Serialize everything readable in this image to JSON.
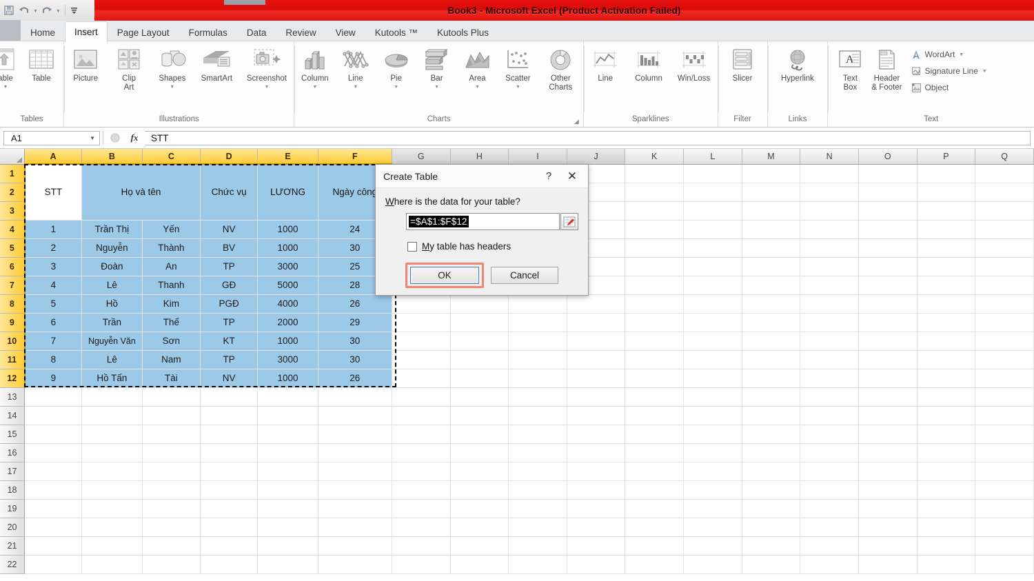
{
  "titlebar": {
    "title": "Book3  -  Microsoft Excel (Product Activation Failed)",
    "qat": [
      {
        "name": "save",
        "glyph": "▤"
      },
      {
        "name": "undo",
        "glyph": "↶"
      },
      {
        "name": "redo",
        "glyph": "↷"
      },
      {
        "name": "customize-quick-access-toolbar",
        "glyph": "☷"
      }
    ]
  },
  "tabs": [
    {
      "label": "Home",
      "active": false
    },
    {
      "label": "Insert",
      "active": true
    },
    {
      "label": "Page Layout",
      "active": false
    },
    {
      "label": "Formulas",
      "active": false
    },
    {
      "label": "Data",
      "active": false
    },
    {
      "label": "Review",
      "active": false
    },
    {
      "label": "View",
      "active": false
    },
    {
      "label": "Kutools ™",
      "active": false
    },
    {
      "label": "Kutools Plus",
      "active": false
    }
  ],
  "ribbon": {
    "groups": [
      {
        "name": "Tables",
        "label": "Tables",
        "items": [
          {
            "label": "able",
            "icon": "pivottable-icon",
            "caret": true
          },
          {
            "label": "Table",
            "icon": "table-icon",
            "caret": false
          }
        ]
      },
      {
        "name": "Illustrations",
        "label": "Illustrations",
        "items": [
          {
            "label": "Picture",
            "icon": "picture-icon",
            "caret": false
          },
          {
            "label": "Clip\nArt",
            "icon": "clipart-icon",
            "caret": false
          },
          {
            "label": "Shapes",
            "icon": "shapes-icon",
            "caret": true
          },
          {
            "label": "SmartArt",
            "icon": "smartart-icon",
            "caret": false
          },
          {
            "label": "Screenshot",
            "icon": "screenshot-icon",
            "caret": true
          }
        ]
      },
      {
        "name": "Charts",
        "label": "Charts",
        "launcher": true,
        "items": [
          {
            "label": "Column",
            "icon": "column-chart-icon",
            "caret": true
          },
          {
            "label": "Line",
            "icon": "line-chart-icon",
            "caret": true
          },
          {
            "label": "Pie",
            "icon": "pie-chart-icon",
            "caret": true
          },
          {
            "label": "Bar",
            "icon": "bar-chart-icon",
            "caret": true
          },
          {
            "label": "Area",
            "icon": "area-chart-icon",
            "caret": true
          },
          {
            "label": "Scatter",
            "icon": "scatter-chart-icon",
            "caret": true
          },
          {
            "label": "Other\nCharts",
            "icon": "other-charts-icon",
            "caret": true,
            "inline_caret": true
          }
        ]
      },
      {
        "name": "Sparklines",
        "label": "Sparklines",
        "items": [
          {
            "label": "Line",
            "icon": "sparkline-line-icon",
            "caret": false
          },
          {
            "label": "Column",
            "icon": "sparkline-column-icon",
            "caret": false
          },
          {
            "label": "Win/Loss",
            "icon": "sparkline-winloss-icon",
            "caret": false
          }
        ]
      },
      {
        "name": "Filter",
        "label": "Filter",
        "items": [
          {
            "label": "Slicer",
            "icon": "slicer-icon",
            "caret": false
          }
        ]
      },
      {
        "name": "Links",
        "label": "Links",
        "items": [
          {
            "label": "Hyperlink",
            "icon": "hyperlink-icon",
            "caret": false
          }
        ]
      },
      {
        "name": "Text",
        "label": "Text",
        "items": [
          {
            "label": "Text\nBox",
            "icon": "textbox-icon",
            "caret": false
          },
          {
            "label": "Header\n& Footer",
            "icon": "header-footer-icon",
            "caret": false
          }
        ],
        "small_items": [
          {
            "label": "WordArt",
            "icon": "wordart-icon",
            "caret": true
          },
          {
            "label": "Signature Line",
            "icon": "signature-line-icon",
            "caret": true
          },
          {
            "label": "Object",
            "icon": "object-icon",
            "caret": false
          }
        ]
      }
    ]
  },
  "formula_bar": {
    "name_box": "A1",
    "formula": "STT",
    "fx_label": "fx",
    "cancel_glyph": "●"
  },
  "grid": {
    "columns": [
      "A",
      "B",
      "C",
      "D",
      "E",
      "F",
      "G",
      "H",
      "I",
      "J",
      "K",
      "L",
      "M",
      "N",
      "O",
      "P",
      "Q"
    ],
    "selected_columns": [
      "A",
      "B",
      "C",
      "D",
      "E",
      "F"
    ],
    "near_selected_columns": [
      "G",
      "H",
      "I",
      "J"
    ],
    "rows": [
      "1",
      "2",
      "3",
      "4",
      "5",
      "6",
      "7",
      "8",
      "9",
      "10",
      "11",
      "12",
      "13",
      "14",
      "15",
      "16",
      "17",
      "18",
      "19",
      "20",
      "21",
      "22"
    ],
    "selected_rows": [
      "1",
      "2",
      "3",
      "4",
      "5",
      "6",
      "7",
      "8",
      "9",
      "10",
      "11",
      "12"
    ],
    "headers": {
      "stt": "STT",
      "name": "Họ và tên",
      "position": "Chức vụ",
      "salary": "LƯƠNG",
      "workdays": "Ngày công"
    },
    "data_rows": [
      {
        "row": "4",
        "stt": "1",
        "ho": "Trần Thị",
        "ten": "Yến",
        "chucvu": "NV",
        "luong": "1000",
        "ngaycong": "24"
      },
      {
        "row": "5",
        "stt": "2",
        "ho": "Nguyễn",
        "ten": "Thành",
        "chucvu": "BV",
        "luong": "1000",
        "ngaycong": "30"
      },
      {
        "row": "6",
        "stt": "3",
        "ho": "Đoàn",
        "ten": "An",
        "chucvu": "TP",
        "luong": "3000",
        "ngaycong": "25"
      },
      {
        "row": "7",
        "stt": "4",
        "ho": "Lê",
        "ten": "Thanh",
        "chucvu": "GĐ",
        "luong": "5000",
        "ngaycong": "28"
      },
      {
        "row": "8",
        "stt": "5",
        "ho": "Hồ",
        "ten": "Kim",
        "chucvu": "PGĐ",
        "luong": "4000",
        "ngaycong": "26"
      },
      {
        "row": "9",
        "stt": "6",
        "ho": "Trần",
        "ten": "Thế",
        "chucvu": "TP",
        "luong": "2000",
        "ngaycong": "29"
      },
      {
        "row": "10",
        "stt": "7",
        "ho": "Nguyễn Văn",
        "ten": "Sơn",
        "chucvu": "KT",
        "luong": "1000",
        "ngaycong": "30"
      },
      {
        "row": "11",
        "stt": "8",
        "ho": "Lê",
        "ten": "Nam",
        "chucvu": "TP",
        "luong": "3000",
        "ngaycong": "30"
      },
      {
        "row": "12",
        "stt": "9",
        "ho": "Hồ Tấn",
        "ten": "Tài",
        "chucvu": "NV",
        "luong": "1000",
        "ngaycong": "26"
      }
    ]
  },
  "dialog": {
    "title": "Create Table",
    "help_glyph": "?",
    "close_glyph": "✕",
    "prompt_pre": "W",
    "prompt_post": "here is the data for your table?",
    "range_value": "=$A$1:$F$12",
    "checkbox": {
      "checked": false,
      "label_pre": "M",
      "label_post": "y table has headers"
    },
    "ok_label": "OK",
    "cancel_label": "Cancel"
  },
  "colors": {
    "title_red": "#dc0c0a",
    "selection_blue": "#9dc9e8",
    "header_yellow": "#ffcc33",
    "ok_highlight": "#f4836c"
  }
}
